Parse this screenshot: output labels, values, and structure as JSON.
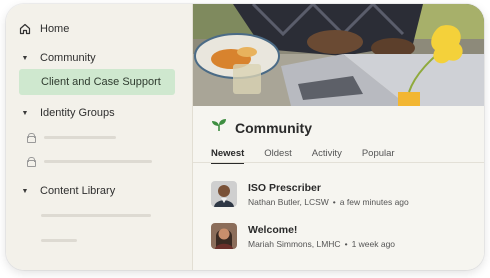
{
  "sidebar": {
    "home_label": "Home",
    "community_label": "Community",
    "active_item_label": "Client and Case Support",
    "identity_groups_label": "Identity Groups",
    "content_library_label": "Content Library"
  },
  "community": {
    "title": "Community",
    "tabs": [
      {
        "label": "Newest",
        "active": true
      },
      {
        "label": "Oldest",
        "active": false
      },
      {
        "label": "Activity",
        "active": false
      },
      {
        "label": "Popular",
        "active": false
      }
    ],
    "posts": [
      {
        "title": "ISO Prescriber",
        "author": "Nathan Butler, LCSW",
        "time": "a few minutes ago"
      },
      {
        "title": "Welcome!",
        "author": "Mariah Simmons, LMHC",
        "time": "1 week ago"
      }
    ]
  },
  "icons": {
    "home": "home-icon",
    "caret": "caret-down-icon",
    "lock": "lock-icon",
    "sprout": "sprout-icon"
  },
  "colors": {
    "sidebar_bg": "#f3f1ea",
    "active_item_bg": "#cfe8cf",
    "accent_green": "#3e8e41"
  }
}
